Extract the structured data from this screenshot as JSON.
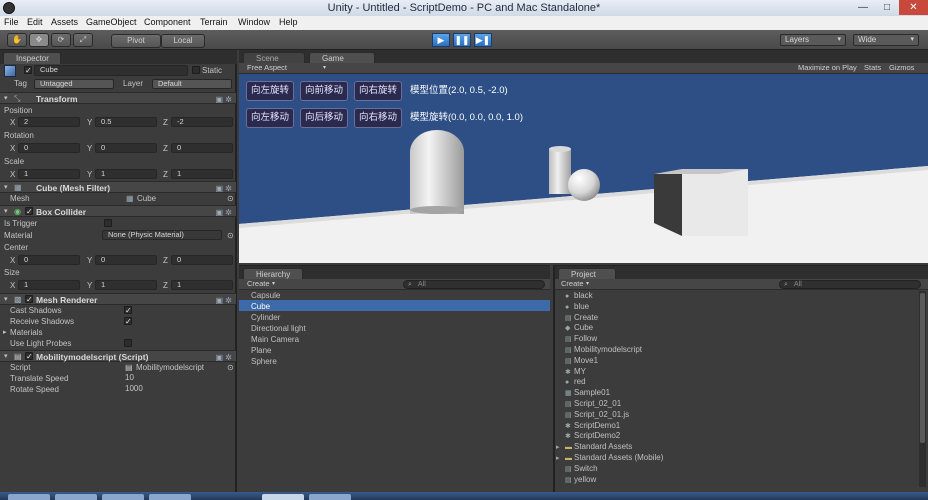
{
  "window": {
    "title": "Unity - Untitled - ScriptDemo - PC and Mac Standalone*",
    "min": "—",
    "max": "□",
    "close": "✕"
  },
  "menu": [
    "File",
    "Edit",
    "Assets",
    "GameObject",
    "Component",
    "Terrain",
    "Window",
    "Help"
  ],
  "toolbar": {
    "tools": [
      "✋",
      "✥",
      "⟳",
      "⤢"
    ],
    "pivot": "Pivot",
    "local": "Local",
    "play": "▶",
    "pause": "❚❚",
    "step": "▶❚",
    "layers": "Layers",
    "layout": "Wide"
  },
  "inspector": {
    "tab": "Inspector",
    "object_name": "Cube",
    "static": "Static",
    "tag_label": "Tag",
    "tag_value": "Untagged",
    "layer_label": "Layer",
    "layer_value": "Default",
    "transform": {
      "title": "Transform",
      "position": "Position",
      "rotation": "Rotation",
      "scale": "Scale",
      "pos": {
        "x": "2",
        "y": "0.5",
        "z": "-2"
      },
      "rot": {
        "x": "0",
        "y": "0",
        "z": "0"
      },
      "scl": {
        "x": "1",
        "y": "1",
        "z": "1"
      },
      "xl": "X",
      "yl": "Y",
      "zl": "Z"
    },
    "mesh_filter": {
      "title": "Cube (Mesh Filter)",
      "mesh_label": "Mesh",
      "mesh_value": "Cube"
    },
    "box_collider": {
      "title": "Box Collider",
      "is_trigger": "Is Trigger",
      "material": "Material",
      "material_value": "None (Physic Material)",
      "center": "Center",
      "size": "Size",
      "c": {
        "x": "0",
        "y": "0",
        "z": "0"
      },
      "s": {
        "x": "1",
        "y": "1",
        "z": "1"
      }
    },
    "mesh_renderer": {
      "title": "Mesh Renderer",
      "cast": "Cast Shadows",
      "receive": "Receive Shadows",
      "materials": "Materials",
      "probes": "Use Light Probes"
    },
    "script_comp": {
      "title": "Mobilitymodelscript (Script)",
      "script": "Script",
      "script_value": "Mobilitymodelscript",
      "translate": "Translate Speed",
      "translate_value": "10",
      "rotate": "Rotate Speed",
      "rotate_value": "1000"
    }
  },
  "scene_tabs": {
    "scene": "Scene",
    "game": "Game",
    "aspect": "Free Aspect",
    "maximize": "Maximize on Play",
    "stats": "Stats",
    "gizmos": "Gizmos"
  },
  "game": {
    "buttons": [
      "向左旋转",
      "向前移动",
      "向右旋转",
      "向左移动",
      "向后移动",
      "向右移动"
    ],
    "position_text": "模型位置(2.0, 0.5, -2.0)",
    "rotation_text": "模型旋转(0.0, 0.0, 0.0, 1.0)"
  },
  "hierarchy": {
    "tab": "Hierarchy",
    "create": "Create",
    "search": "All",
    "items": [
      "Capsule",
      "Cube",
      "Cylinder",
      "Directional light",
      "Main Camera",
      "Plane",
      "Sphere"
    ],
    "selected_index": 1
  },
  "project": {
    "tab": "Project",
    "create": "Create",
    "search": "All",
    "items": [
      {
        "icon": "●",
        "label": "black"
      },
      {
        "icon": "●",
        "label": "blue"
      },
      {
        "icon": "▤",
        "label": "Create"
      },
      {
        "icon": "◆",
        "label": "Cube"
      },
      {
        "icon": "▤",
        "label": "Follow"
      },
      {
        "icon": "▤",
        "label": "Mobilitymodelscript"
      },
      {
        "icon": "▤",
        "label": "Move1"
      },
      {
        "icon": "✱",
        "label": "MY"
      },
      {
        "icon": "●",
        "label": "red"
      },
      {
        "icon": "▦",
        "label": "Sample01"
      },
      {
        "icon": "▤",
        "label": "Script_02_01"
      },
      {
        "icon": "▤",
        "label": "Script_02_01.js"
      },
      {
        "icon": "✱",
        "label": "ScriptDemo1"
      },
      {
        "icon": "✱",
        "label": "ScriptDemo2"
      },
      {
        "icon": "▸",
        "label": "Standard Assets"
      },
      {
        "icon": "▸",
        "label": "Standard Assets (Mobile)"
      },
      {
        "icon": "▤",
        "label": "Switch"
      },
      {
        "icon": "▤",
        "label": "yellow"
      }
    ]
  }
}
